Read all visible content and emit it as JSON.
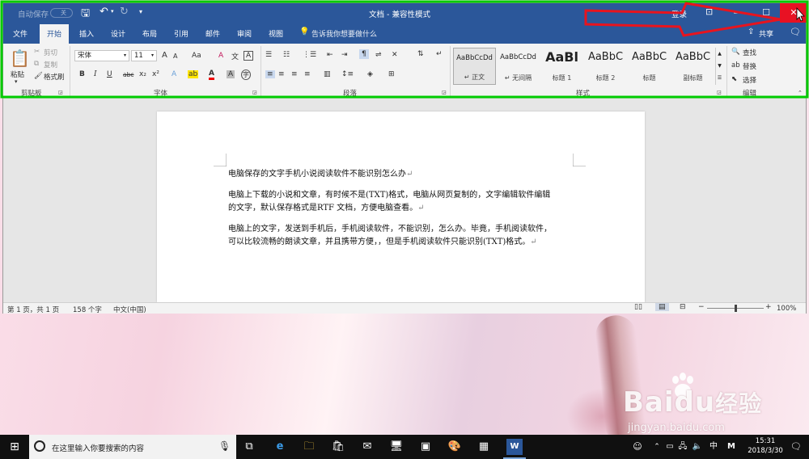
{
  "titlebar": {
    "autosave_label": "自动保存",
    "autosave_toggle": "关",
    "title": "文档 - 兼容性模式",
    "signin": "登录",
    "minimize": "—",
    "restore": "☐",
    "close": "✕",
    "options_icon": "⊡"
  },
  "tabs": [
    "文件",
    "开始",
    "插入",
    "设计",
    "布局",
    "引用",
    "邮件",
    "审阅",
    "视图"
  ],
  "active_tab": "开始",
  "tell_me": "告诉我你想要做什么",
  "share": "共享",
  "clipboard": {
    "paste": "粘贴",
    "cut": "剪切",
    "copy": "复制",
    "format_painter": "格式刷",
    "group_label": "剪贴板"
  },
  "font": {
    "name": "宋体",
    "size": "11",
    "group_label": "字体",
    "grow": "A",
    "shrink": "A",
    "case": "Aa",
    "clear": "A",
    "phonetic": "文",
    "border_char": "A",
    "bold": "B",
    "italic": "I",
    "underline": "U",
    "strike": "abc",
    "sub": "x₂",
    "sup": "x²",
    "effects": "A",
    "highlight": "ab",
    "color": "A",
    "shade": "A",
    "enclose": "字"
  },
  "paragraph": {
    "group_label": "段落"
  },
  "styles": {
    "group_label": "样式",
    "items": [
      {
        "sample": "AaBbCcDd",
        "name": "↵ 正文"
      },
      {
        "sample": "AaBbCcDd",
        "name": "↵ 无间隔"
      },
      {
        "sample": "AaBl",
        "name": "标题 1"
      },
      {
        "sample": "AaBbC",
        "name": "标题 2"
      },
      {
        "sample": "AaBbC",
        "name": "标题"
      },
      {
        "sample": "AaBbC",
        "name": "副标题"
      }
    ]
  },
  "editing": {
    "group_label": "编辑",
    "find": "查找",
    "replace": "替换",
    "select": "选择"
  },
  "document": {
    "heading": "电脑保存的文字手机小说阅读软件不能识别怎么办",
    "p1_line1": "电脑上下载的小说和文章，有时候不是(TXT)格式，电脑从网页复制的，文字编辑软件编辑",
    "p1_line2": "的文字，默认保存格式是RTF 文档，方便电脑查看。",
    "p2_line1": "电脑上的文字，发送到手机后，手机阅读软件，不能识别，怎么办。毕竟，手机阅读软件，",
    "p2_line2": "可以比较流畅的朗读文章，并且携带方便，，但是手机阅读软件只能识别(TXT)格式。",
    "para_mark": "↵"
  },
  "status": {
    "page": "第 1 页，共 1 页",
    "words": "158 个字",
    "language": "中文(中国)",
    "zoom": "100%",
    "zoom_level": 1.0
  },
  "taskbar": {
    "search_placeholder": "在这里输入你要搜索的内容",
    "ime": "中",
    "ime_mode": "M",
    "time": "15:31",
    "date": "2018/3/30"
  },
  "watermark": {
    "brand": "Bai",
    "brand2": "du",
    "cn": "经验",
    "url": "jingyan.baidu.com"
  },
  "colors": {
    "titlebar": "#2b579a",
    "close_button": "#e81123",
    "highlight_border": "#00cc00",
    "arrow": "#e8141e"
  }
}
